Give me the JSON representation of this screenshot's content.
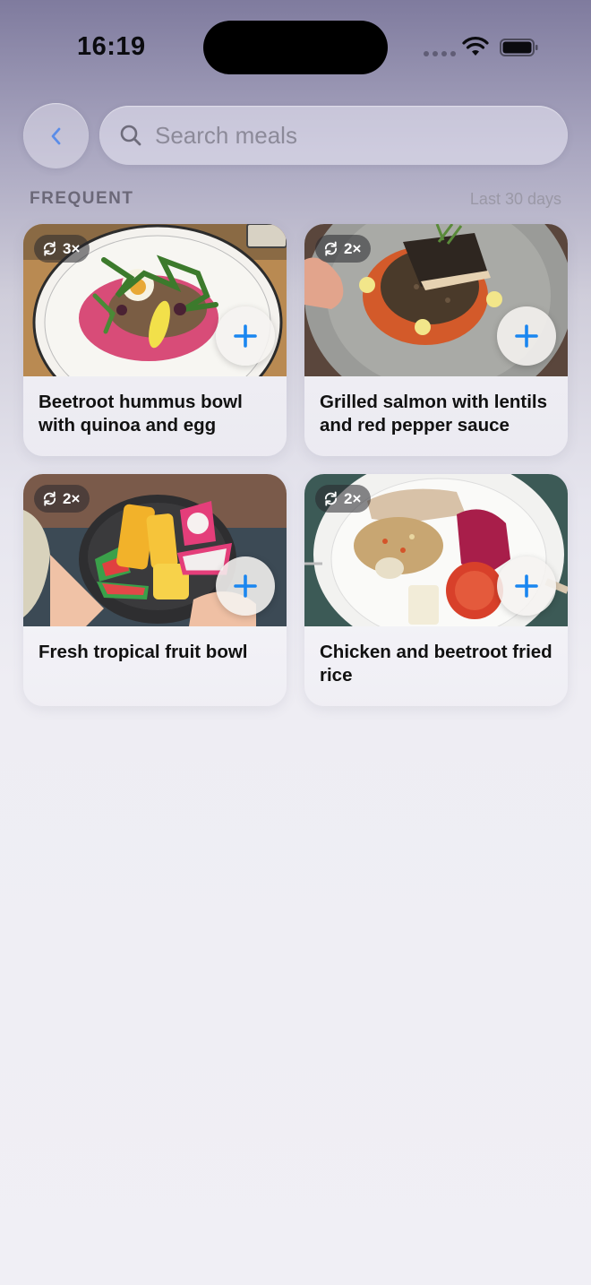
{
  "status": {
    "time": "16:19"
  },
  "search": {
    "placeholder": "Search meals"
  },
  "section": {
    "title": "FREQUENT",
    "range": "Last 30 days"
  },
  "meals": [
    {
      "title": "Beetroot hummus bowl with quinoa and egg",
      "count": "3×"
    },
    {
      "title": "Grilled salmon with lentils and red pepper sauce",
      "count": "2×"
    },
    {
      "title": "Fresh tropical fruit bowl",
      "count": "2×"
    },
    {
      "title": "Chicken and beetroot fried rice",
      "count": "2×"
    }
  ],
  "colors": {
    "accent": "#1a86f0",
    "back_chevron": "#5b8de8"
  },
  "icons": {
    "back": "chevron-left-icon",
    "search": "magnifier-icon",
    "repeat": "repeat-icon",
    "add": "plus-icon"
  }
}
